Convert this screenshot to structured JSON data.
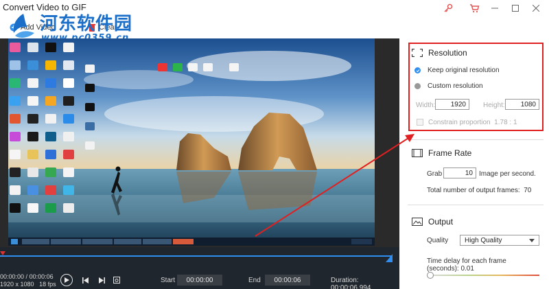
{
  "window": {
    "title": "Convert Video to GIF"
  },
  "watermark": {
    "text": "河东软件园",
    "url": "www.pc0359.cn"
  },
  "toolbar": {
    "add_video": "Add Video",
    "clear": "Clear"
  },
  "controls": {
    "current_time": "00:00:00",
    "total_time": "00:00:06",
    "dimensions": "1920 x 1080",
    "fps": "18 fps",
    "start_label": "Start",
    "start_value": "00:00:00",
    "end_label": "End",
    "end_value": "00:00:06",
    "duration": "Duration: 00:00:06.994"
  },
  "resolution": {
    "title": "Resolution",
    "keep_original": "Keep original resolution",
    "custom": "Custom resolution",
    "width_label": "Width:",
    "width_value": "1920",
    "height_label": "Height:",
    "height_value": "1080",
    "constrain_label": "Constrain proportion",
    "constrain_value": "1.78 : 1"
  },
  "frame_rate": {
    "title": "Frame Rate",
    "grab_label": "Grab",
    "grab_value": "10",
    "per_second": "Image per second.",
    "total_frames_label": "Total number of output frames:",
    "total_frames_value": "70"
  },
  "output": {
    "title": "Output",
    "quality_label": "Quality",
    "quality_value": "High Quality",
    "delay_label": "Time delay for each frame (seconds):",
    "delay_value": "0.01"
  },
  "colors": {
    "accent_blue": "#2f8ef0",
    "highlight_red": "#e02020",
    "control_bg": "#20262d"
  }
}
